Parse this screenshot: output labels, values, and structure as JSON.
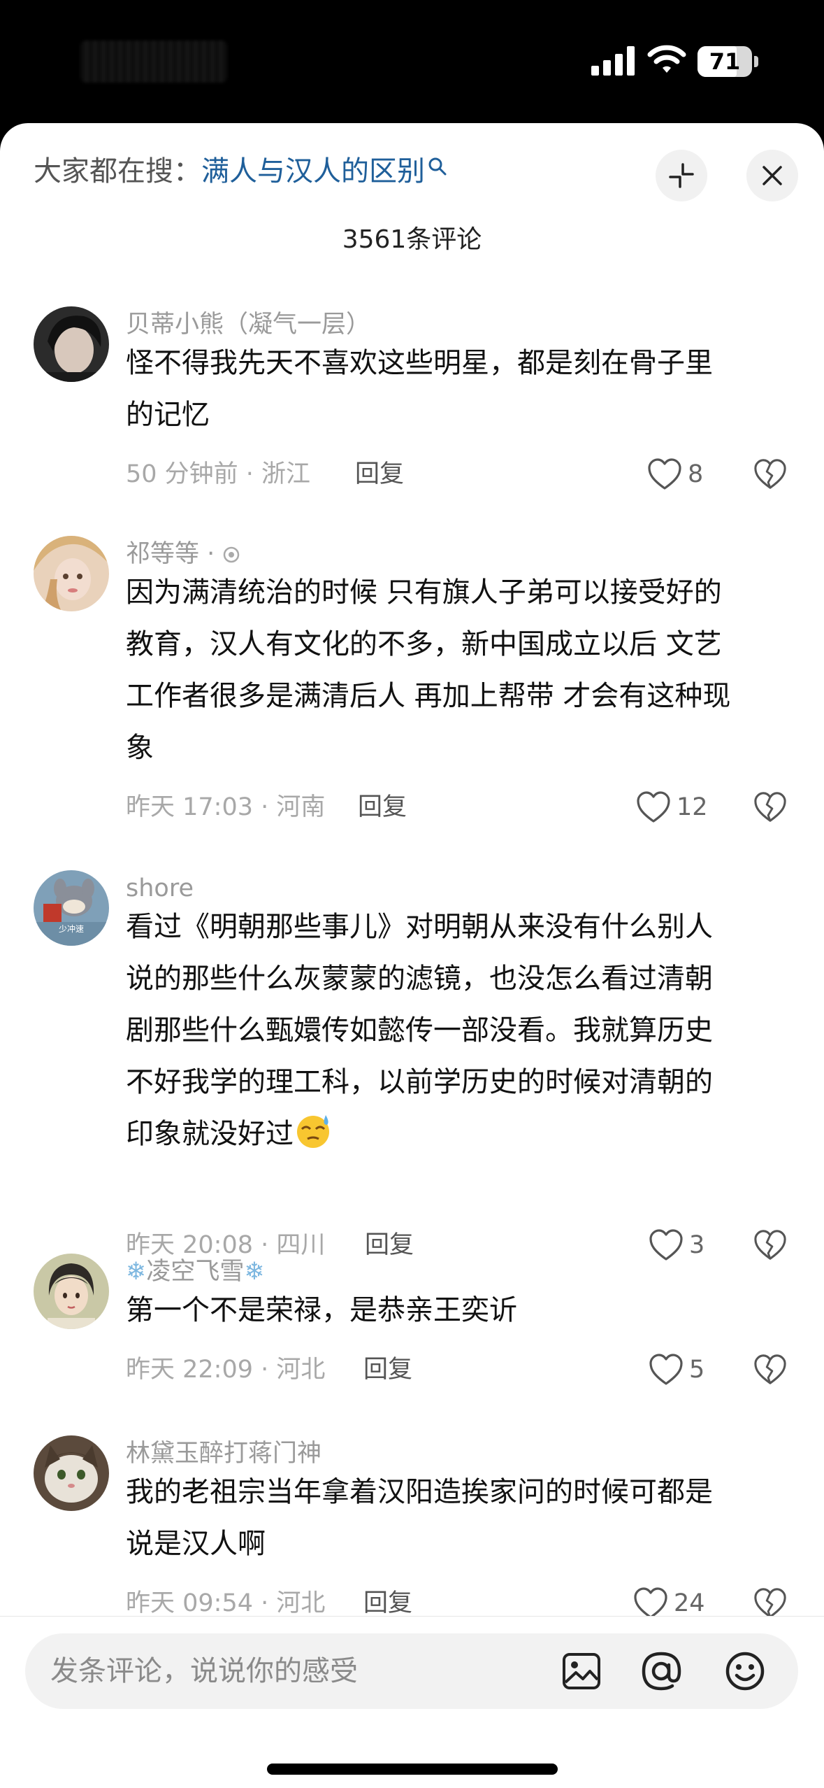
{
  "status_bar": {
    "battery": "71"
  },
  "header": {
    "search_prefix": "大家都在搜：",
    "search_query": "满人与汉人的区别",
    "comment_count": "3561条评论"
  },
  "comments": [
    {
      "username": "贝蒂小熊（凝气一层）",
      "lines": [
        "怪不得我先天不喜欢这些明星，都是刻在骨子里",
        "的记忆"
      ],
      "meta": "50 分钟前 · 浙江",
      "reply": "回复",
      "likes": "8"
    },
    {
      "username": "祁等等 ·",
      "lines": [
        "因为满清统治的时候 只有旗人子弟可以接受好的",
        "教育，汉人有文化的不多，新中国成立以后 文艺",
        "工作者很多是满清后人 再加上帮带 才会有这种现",
        "象"
      ],
      "meta": "昨天 17:03 · 河南",
      "reply": "回复",
      "likes": "12"
    },
    {
      "username": "shore",
      "avatar_text": "少冲速",
      "lines": [
        "看过《明朝那些事儿》对明朝从来没有什么别人",
        "说的那些什么灰蒙蒙的滤镜，也没怎么看过清朝",
        "剧那些什么甄嬛传如懿传一部没看。我就算历史",
        "不好我学的理工科，以前学历史的时候对清朝的",
        "印象就没好过"
      ],
      "meta": "昨天 20:08 · 四川",
      "reply": "回复",
      "likes": "3"
    },
    {
      "username": "凌空飞雪",
      "lines": [
        "第一个不是荣禄，是恭亲王奕䜣"
      ],
      "meta": "昨天 22:09 · 河北",
      "reply": "回复",
      "likes": "5"
    },
    {
      "username": "林黛玉醉打蒋门神",
      "lines": [
        "我的老祖宗当年拿着汉阳造挨家问的时候可都是",
        "说是汉人啊"
      ],
      "meta": "昨天 09:54 · 河北",
      "reply": "回复",
      "likes": "24"
    }
  ],
  "input": {
    "placeholder": "发条评论，说说你的感受"
  },
  "icons": {
    "status": [
      "signal-icon",
      "wifi-icon",
      "battery-icon"
    ],
    "header": [
      "search-icon",
      "collapse-icon",
      "close-icon"
    ],
    "comment": [
      "heart-icon",
      "broken-heart-icon",
      "level-badge-icon",
      "snowflake-icon",
      "sweat-emoji-icon"
    ],
    "bottom": [
      "image-icon",
      "at-icon",
      "emoji-icon"
    ]
  },
  "colors": {
    "link_blue": "#1f5f9a",
    "muted_text": "#a8a8a8"
  }
}
